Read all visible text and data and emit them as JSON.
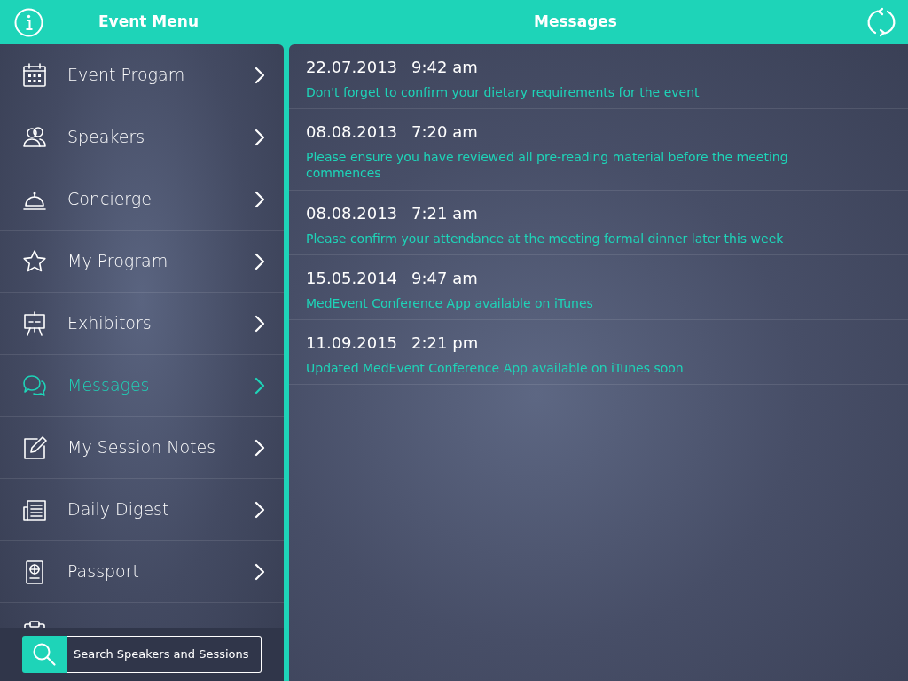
{
  "header": {
    "left_title": "Event Menu",
    "right_title": "Messages"
  },
  "sidebar": {
    "items": [
      {
        "label": "Event Progam",
        "selected": false
      },
      {
        "label": "Speakers",
        "selected": false
      },
      {
        "label": "Concierge",
        "selected": false
      },
      {
        "label": "My Program",
        "selected": false
      },
      {
        "label": "Exhibitors",
        "selected": false
      },
      {
        "label": "Messages",
        "selected": true
      },
      {
        "label": "My Session Notes",
        "selected": false
      },
      {
        "label": "Daily Digest",
        "selected": false
      },
      {
        "label": "Passport",
        "selected": false
      }
    ]
  },
  "search": {
    "placeholder": "Search Speakers and Sessions"
  },
  "messages": [
    {
      "date": "22.07.2013",
      "time": "9:42 am",
      "text": "Don't forget to confirm your dietary requirements for the event"
    },
    {
      "date": "08.08.2013",
      "time": "7:20 am",
      "text": "Please ensure you have reviewed all pre-reading material before the meeting commences"
    },
    {
      "date": "08.08.2013",
      "time": "7:21 am",
      "text": "Please confirm your attendance at the meeting formal dinner later this week"
    },
    {
      "date": "15.05.2014",
      "time": "9:47 am",
      "text": "MedEvent Conference App available on iTunes"
    },
    {
      "date": "11.09.2015",
      "time": "2:21 pm",
      "text": "Updated MedEvent Conference App available on iTunes soon"
    }
  ]
}
